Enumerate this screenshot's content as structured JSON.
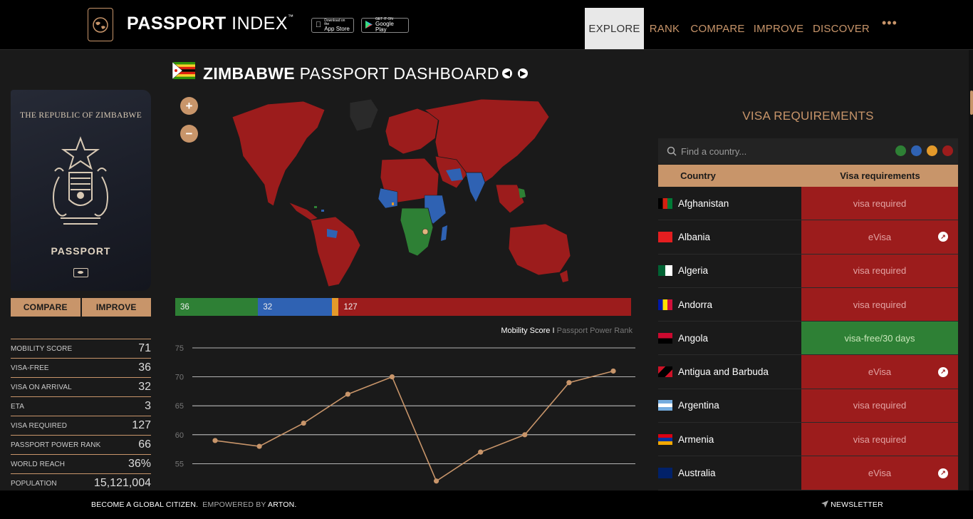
{
  "header": {
    "brand_bold": "PASSPORT",
    "brand_light": "INDEX",
    "brand_tm": "™",
    "app_store_small": "Download on the",
    "app_store": "App Store",
    "google_play_small": "GET IT ON",
    "google_play": "Google Play",
    "nav": [
      "EXPLORE",
      "RANK",
      "COMPARE",
      "IMPROVE",
      "DISCOVER"
    ],
    "nav_active": "EXPLORE",
    "more": "•••"
  },
  "passport": {
    "title": "THE REPUBLIC OF ZIMBABWE",
    "word": "PASSPORT",
    "compare_label": "COMPARE",
    "improve_label": "IMPROVE"
  },
  "stats": [
    {
      "label": "MOBILITY SCORE",
      "value": "71"
    },
    {
      "label": "VISA-FREE",
      "value": "36"
    },
    {
      "label": "VISA ON ARRIVAL",
      "value": "32"
    },
    {
      "label": "ETA",
      "value": "3"
    },
    {
      "label": "VISA REQUIRED",
      "value": "127"
    },
    {
      "label": "PASSPORT POWER RANK",
      "value": "66"
    },
    {
      "label": "WORLD REACH",
      "value": "36%"
    },
    {
      "label": "POPULATION",
      "value": "15,121,004"
    }
  ],
  "dashboard": {
    "title_bold": "ZIMBABWE",
    "title_rest": "PASSPORT DASHBOARD",
    "prev_icon": "◀",
    "next_icon": "▶",
    "zoom_in": "+",
    "zoom_out": "−"
  },
  "breakdown": [
    {
      "value": 36,
      "label": "36",
      "color": "#2e8035"
    },
    {
      "value": 32,
      "label": "32",
      "color": "#2f62b3"
    },
    {
      "value": 3,
      "label": "",
      "color": "#e49a2a"
    },
    {
      "value": 127,
      "label": "127",
      "color": "#9c1c1c"
    }
  ],
  "chart_legend": {
    "active": "Mobility Score",
    "separator": "I",
    "inactive": "Passport Power Rank"
  },
  "chart_data": {
    "type": "line",
    "series": [
      {
        "name": "Mobility Score",
        "values": [
          59,
          58,
          62,
          67,
          70,
          52,
          57,
          60,
          69,
          71
        ]
      }
    ],
    "y_ticks": [
      75,
      70,
      65,
      60,
      55
    ],
    "ylim": [
      50,
      75
    ],
    "grid": true,
    "line_color": "#c8956a"
  },
  "visa": {
    "title": "VISA REQUIREMENTS",
    "search_placeholder": "Find a country...",
    "filter_colors": [
      "#2e8035",
      "#2f62b3",
      "#e49a2a",
      "#9c1c1c"
    ],
    "col_country": "Country",
    "col_requirement": "Visa requirements",
    "rows": [
      {
        "country": "Afghanistan",
        "req": "visa required",
        "status": "red",
        "link": false
      },
      {
        "country": "Albania",
        "req": "eVisa",
        "status": "red",
        "link": true
      },
      {
        "country": "Algeria",
        "req": "visa required",
        "status": "red",
        "link": false
      },
      {
        "country": "Andorra",
        "req": "visa required",
        "status": "red",
        "link": false
      },
      {
        "country": "Angola",
        "req": "visa-free/30 days",
        "status": "green",
        "link": false
      },
      {
        "country": "Antigua and Barbuda",
        "req": "eVisa",
        "status": "red",
        "link": true
      },
      {
        "country": "Argentina",
        "req": "visa required",
        "status": "red",
        "link": false
      },
      {
        "country": "Armenia",
        "req": "visa required",
        "status": "red",
        "link": false
      },
      {
        "country": "Australia",
        "req": "eVisa",
        "status": "red",
        "link": true
      }
    ]
  },
  "footer": {
    "tagline": "BECOME A GLOBAL CITIZEN.",
    "empowered": "EMPOWERED BY",
    "partner": "ARTON.",
    "newsletter": "NEWSLETTER"
  }
}
